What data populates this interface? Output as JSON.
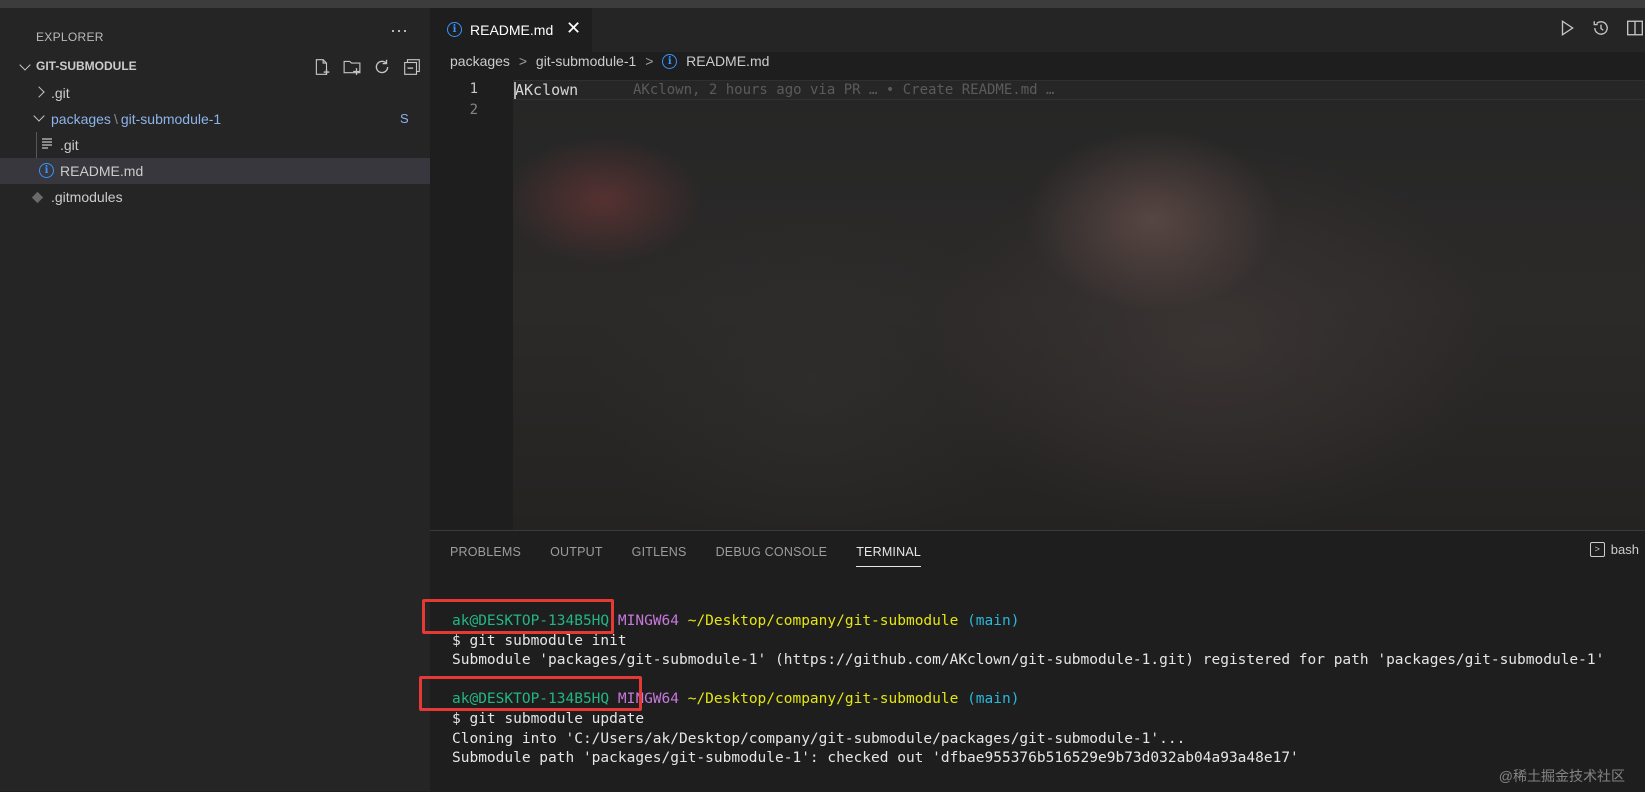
{
  "sidebar": {
    "title": "EXPLORER",
    "more_label": "···",
    "section_label": "GIT-SUBMODULE",
    "tree": {
      "git": ".git",
      "packages": "packages",
      "packages_sep": "\\",
      "submodule": "git-submodule-1",
      "submodule_badge": "S",
      "sub_git": ".git",
      "readme": "README.md",
      "gitmodules": ".gitmodules"
    }
  },
  "editor": {
    "tab_label": "README.md",
    "tab_close": "✕",
    "breadcrumb": [
      "packages",
      "git-submodule-1",
      "README.md"
    ],
    "breadcrumb_sep": ">",
    "lines": [
      "1",
      "2"
    ],
    "line1": "AKclown",
    "blame": "AKclown, 2 hours ago via PR … • Create README.md …"
  },
  "panel": {
    "tabs": [
      "PROBLEMS",
      "OUTPUT",
      "GITLENS",
      "DEBUG CONSOLE",
      "TERMINAL"
    ],
    "active_tab": "TERMINAL",
    "shell_label": "bash",
    "terminal": {
      "prompt_user": "ak@DESKTOP-134B5HQ",
      "prompt_host": "MINGW64",
      "prompt_path": "~/Desktop/company/git-submodule",
      "prompt_branch": "(main)",
      "cmd1": "$ git submodule init",
      "out1": "Submodule 'packages/git-submodule-1' (https://github.com/AKclown/git-submodule-1.git) registered for path 'packages/git-submodule-1'",
      "cmd2": "$ git submodule update",
      "out2": "Cloning into 'C:/Users/ak/Desktop/company/git-submodule/packages/git-submodule-1'...",
      "out3": "Submodule path 'packages/git-submodule-1': checked out 'dfbae955376b516529e9b73d032ab04a93a48e17'"
    }
  },
  "watermark": "@稀土掘金技术社区",
  "colors": {
    "accent": "#3794ff",
    "highlight_box": "#e53935",
    "prompt_green": "#23b685",
    "prompt_yellow": "#e5e510",
    "prompt_cyan": "#29b8db"
  }
}
